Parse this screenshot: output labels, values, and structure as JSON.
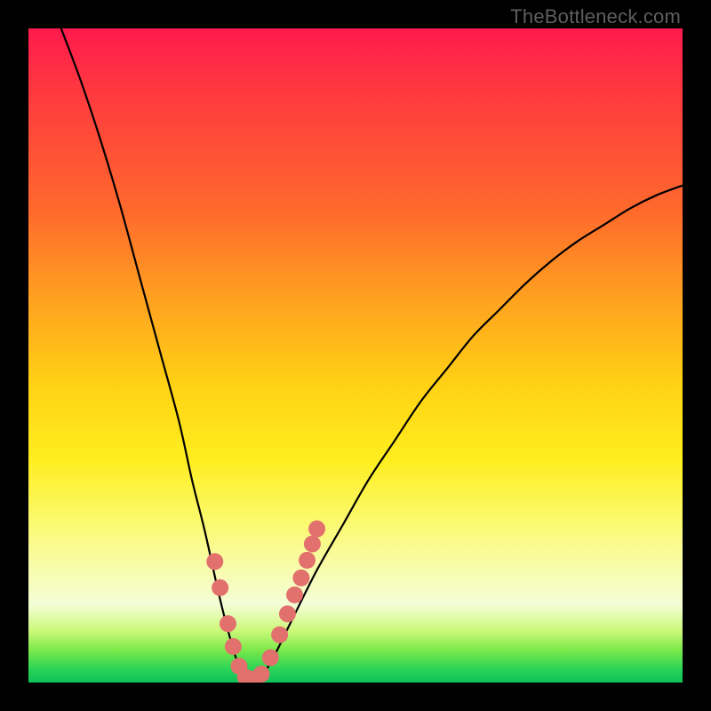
{
  "watermark": "TheBottleneck.com",
  "colors": {
    "frame": "#000000",
    "curve_stroke": "#000000",
    "marker_fill": "#e2716e",
    "marker_stroke": "#c85a57"
  },
  "chart_data": {
    "type": "line",
    "title": "",
    "xlabel": "",
    "ylabel": "",
    "xlim": [
      0,
      100
    ],
    "ylim": [
      0,
      100
    ],
    "grid": false,
    "legend": false,
    "series": [
      {
        "name": "bottleneck-curve",
        "x": [
          5,
          8,
          11,
          14,
          17,
          20,
          23,
          25,
          27,
          29,
          30.5,
          32,
          33.5,
          35,
          37,
          40,
          44,
          48,
          52,
          56,
          60,
          64,
          68,
          72,
          76,
          80,
          84,
          88,
          92,
          96,
          100
        ],
        "y": [
          100,
          92,
          83,
          73,
          62,
          51,
          40,
          31,
          23,
          14,
          8,
          3,
          0.5,
          0.5,
          3,
          9,
          17,
          24,
          31,
          37,
          43,
          48,
          53,
          57,
          61,
          64.5,
          67.5,
          70,
          72.5,
          74.5,
          76
        ]
      }
    ],
    "highlighted_points": {
      "name": "marker-cluster",
      "x": [
        28.5,
        29.3,
        30.5,
        31.3,
        32.2,
        33.2,
        34.4,
        35.6,
        37.0,
        38.4,
        39.6,
        40.7,
        41.7,
        42.6,
        43.4,
        44.1
      ],
      "y": [
        18.5,
        14.5,
        9.0,
        5.5,
        2.5,
        0.8,
        0.5,
        1.3,
        3.8,
        7.3,
        10.5,
        13.4,
        16.0,
        18.7,
        21.2,
        23.5
      ]
    }
  }
}
